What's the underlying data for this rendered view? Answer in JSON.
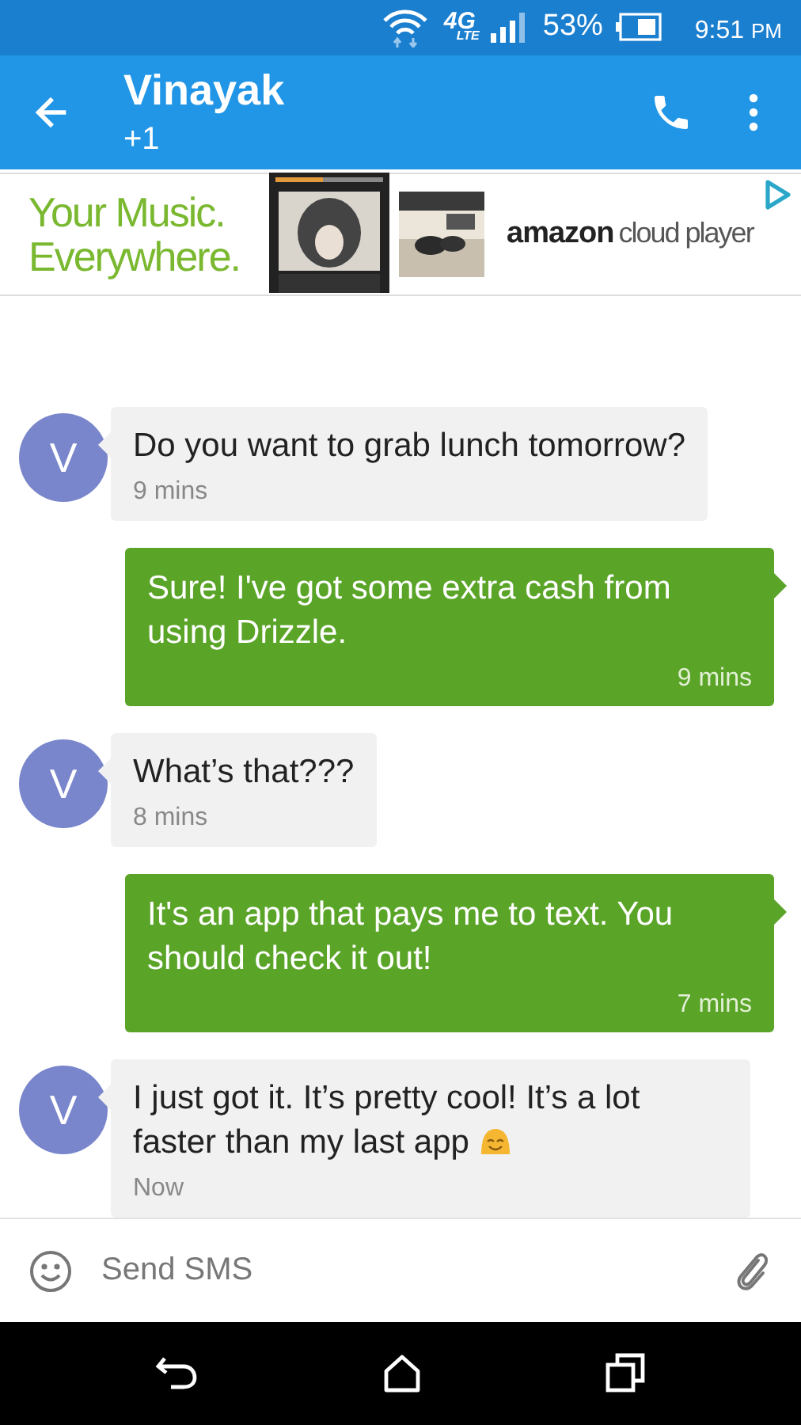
{
  "status_bar": {
    "network": "4G",
    "network_sub": "LTE",
    "battery": "53%",
    "time": "9:51",
    "meridiem": "PM"
  },
  "app_bar": {
    "title": "Vinayak",
    "subtitle": "+1"
  },
  "ad": {
    "headline": [
      "Your Music.",
      "Everywhere."
    ],
    "brand": "amazon",
    "product": "cloud player"
  },
  "messages": [
    {
      "kind": "incoming",
      "avatar": "V",
      "text": "Do you want to grab lunch tomorrow?",
      "time": "9 mins"
    },
    {
      "kind": "outgoing",
      "text": "Sure! I've got some extra cash from using Drizzle.",
      "time": "9 mins"
    },
    {
      "kind": "incoming",
      "avatar": "V",
      "text": "What’s that???",
      "time": "8 mins"
    },
    {
      "kind": "outgoing",
      "text": "It's an app that pays me to text. You should check it out!",
      "time": "7 mins"
    },
    {
      "kind": "incoming",
      "avatar": "V",
      "text": "I just got it. It’s pretty cool! It’s a lot faster than my last app",
      "emoji": true,
      "time": "Now"
    }
  ],
  "composer": {
    "placeholder": "Send SMS"
  }
}
